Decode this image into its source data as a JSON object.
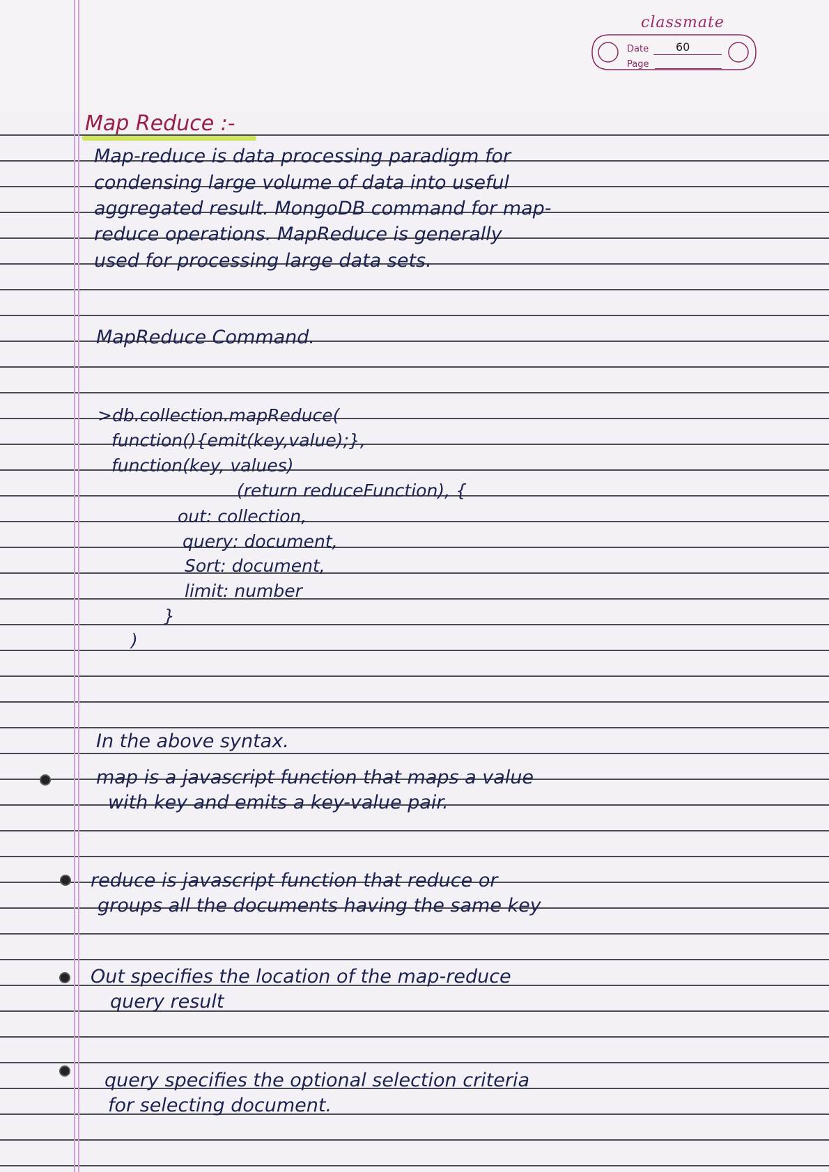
{
  "header": {
    "brand": "classmate",
    "date_label": "Date",
    "date_value": "60",
    "page_label": "Page"
  },
  "content": {
    "title": "Map Reduce :-",
    "intro": [
      "Map-reduce is data processing paradigm for",
      "condensing large volume of data into useful",
      "aggregated result. MongoDB command for map-",
      "reduce operations. MapReduce is generally",
      "used for processing large data sets."
    ],
    "subheading": "MapReduce Command.",
    "code": [
      ">db.collection.mapReduce(",
      "function(){emit(key,value);},",
      "function(key, values)",
      "(return reduceFunction), {",
      "out: collection,",
      "query: document,",
      "Sort: document,",
      "limit: number",
      "}",
      ")"
    ],
    "explanation_heading": "In the above syntax.",
    "explanations": [
      "map is a javascript function that maps a value",
      "with key and emits a key-value pair.",
      "reduce is javascript function that reduce or",
      "groups all the documents having the same key",
      "Out specifies the location of the map-reduce",
      "query result",
      "query specifies the optional selection criteria",
      "for selecting document."
    ]
  }
}
